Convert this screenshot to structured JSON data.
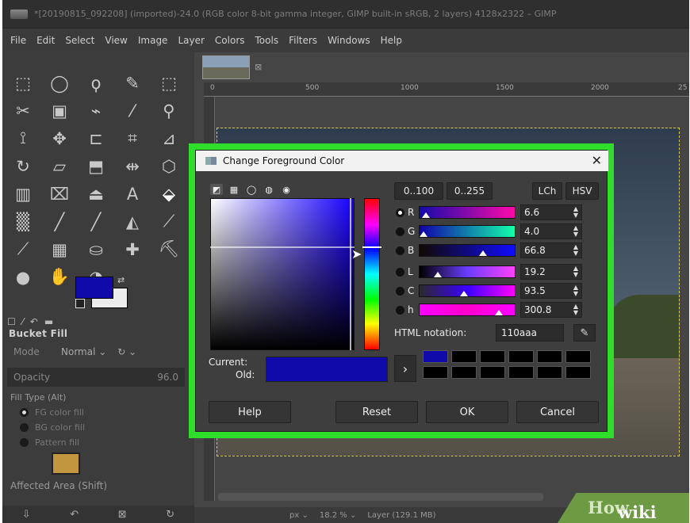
{
  "window": {
    "title": "*[20190815_092208] (imported)-24.0 (RGB color 8-bit gamma integer, GIMP built-in sRGB, 2 layers) 4128x2322 – GIMP"
  },
  "menu": [
    "File",
    "Edit",
    "Select",
    "View",
    "Image",
    "Layer",
    "Colors",
    "Tools",
    "Filters",
    "Windows",
    "Help"
  ],
  "toolbox": {
    "tools": [
      "rect-select",
      "ellipse-select",
      "free-select",
      "fuzzy-select",
      "select-by-color",
      "scissors-select",
      "foreground-select",
      "paths",
      "color-picker",
      "zoom",
      "measure",
      "move",
      "align",
      "crop",
      "unified-transform",
      "rotate",
      "shear",
      "perspective",
      "flip",
      "3d-transform",
      "warp-transform",
      "cage-transform",
      "fill-bucket",
      "text",
      "bucket-fill",
      "gradient",
      "pencil",
      "paintbrush",
      "eraser",
      "airbrush",
      "ink",
      "mypaint-brush",
      "clone",
      "heal",
      "perspective-clone",
      "blur",
      "smudge",
      "dodge-burn"
    ],
    "tool_glyphs": [
      "⬚",
      "◯",
      "ϙ",
      "✎",
      "⬚",
      "✂",
      "▣",
      "⌁",
      "⁄",
      "⚲",
      "⟟",
      "✥",
      "⊏",
      "⌗",
      "⊿",
      "↻",
      "▱",
      "⬒",
      "⇹",
      "⬡",
      "▥",
      "⌧",
      "⏏",
      "A",
      "⬙",
      "▒",
      "╱",
      "╱",
      "◭",
      "⟋",
      "⟋",
      "▦",
      "⛀",
      "✚",
      "⛏",
      "●",
      "✋",
      "◔"
    ],
    "active_tool": "Bucket Fill",
    "mode_label": "Mode",
    "mode_value": "Normal ⌄",
    "opacity_label": "Opacity",
    "opacity_value": "96.0",
    "fill_type_label": "Fill Type  (Alt)",
    "fill_options": [
      "FG color fill",
      "BG color fill",
      "Pattern fill"
    ],
    "affected_area_label": "Affected Area  (Shift)",
    "fg_color": "#110aaa",
    "bg_color": "#ededed"
  },
  "ruler": {
    "marks": [
      "0",
      "500",
      "1000",
      "1500",
      "2000",
      "25"
    ]
  },
  "statusbar": {
    "unit": "px ⌄",
    "zoom": "18.2 % ⌄",
    "layer_info": "Layer (129.1 MB)"
  },
  "watermark": {
    "wiki": "wiki",
    "how": "How"
  },
  "dialog": {
    "title": "Change Foreground Color",
    "range_0_100": "0..100",
    "range_0_255": "0..255",
    "mode_lch": "LCh",
    "mode_hsv": "HSV",
    "channels": [
      {
        "label": "R",
        "value": "6.6",
        "fraction": 0.066,
        "selected": true,
        "gradient": "linear-gradient(90deg,#110aaa,#ff0aaa)"
      },
      {
        "label": "G",
        "value": "4.0",
        "fraction": 0.04,
        "selected": false,
        "gradient": "linear-gradient(90deg,#1100aa,#11ffaa)"
      },
      {
        "label": "B",
        "value": "66.8",
        "fraction": 0.668,
        "selected": false,
        "gradient": "linear-gradient(90deg,#110a00,#110aff)"
      },
      {
        "label": "L",
        "value": "19.2",
        "fraction": 0.192,
        "selected": false,
        "gradient": "linear-gradient(90deg,#000000,#6a3cff,#ff40ff)"
      },
      {
        "label": "C",
        "value": "93.5",
        "fraction": 0.467,
        "selected": false,
        "gradient": "linear-gradient(90deg,#2a2a2a,#3a00ff,#ff00ff)"
      },
      {
        "label": "h",
        "value": "300.8",
        "fraction": 0.836,
        "selected": false,
        "gradient": "linear-gradient(90deg,#ff00ff,#ff00cc,#ff00ff)"
      }
    ],
    "html_label": "HTML notation:",
    "html_value": "110aaa",
    "current_label": "Current:",
    "old_label": "Old:",
    "current_color": "#110aaa",
    "history": [
      "#110aaa",
      "#000000",
      "#000000",
      "#000000",
      "#000000",
      "#000000",
      "#000000",
      "#000000",
      "#000000",
      "#000000",
      "#000000",
      "#000000"
    ],
    "buttons": {
      "help": "Help",
      "reset": "Reset",
      "ok": "OK",
      "cancel": "Cancel"
    }
  },
  "colors": {
    "highlight": "#2ede2a",
    "accent": "#110aaa"
  }
}
